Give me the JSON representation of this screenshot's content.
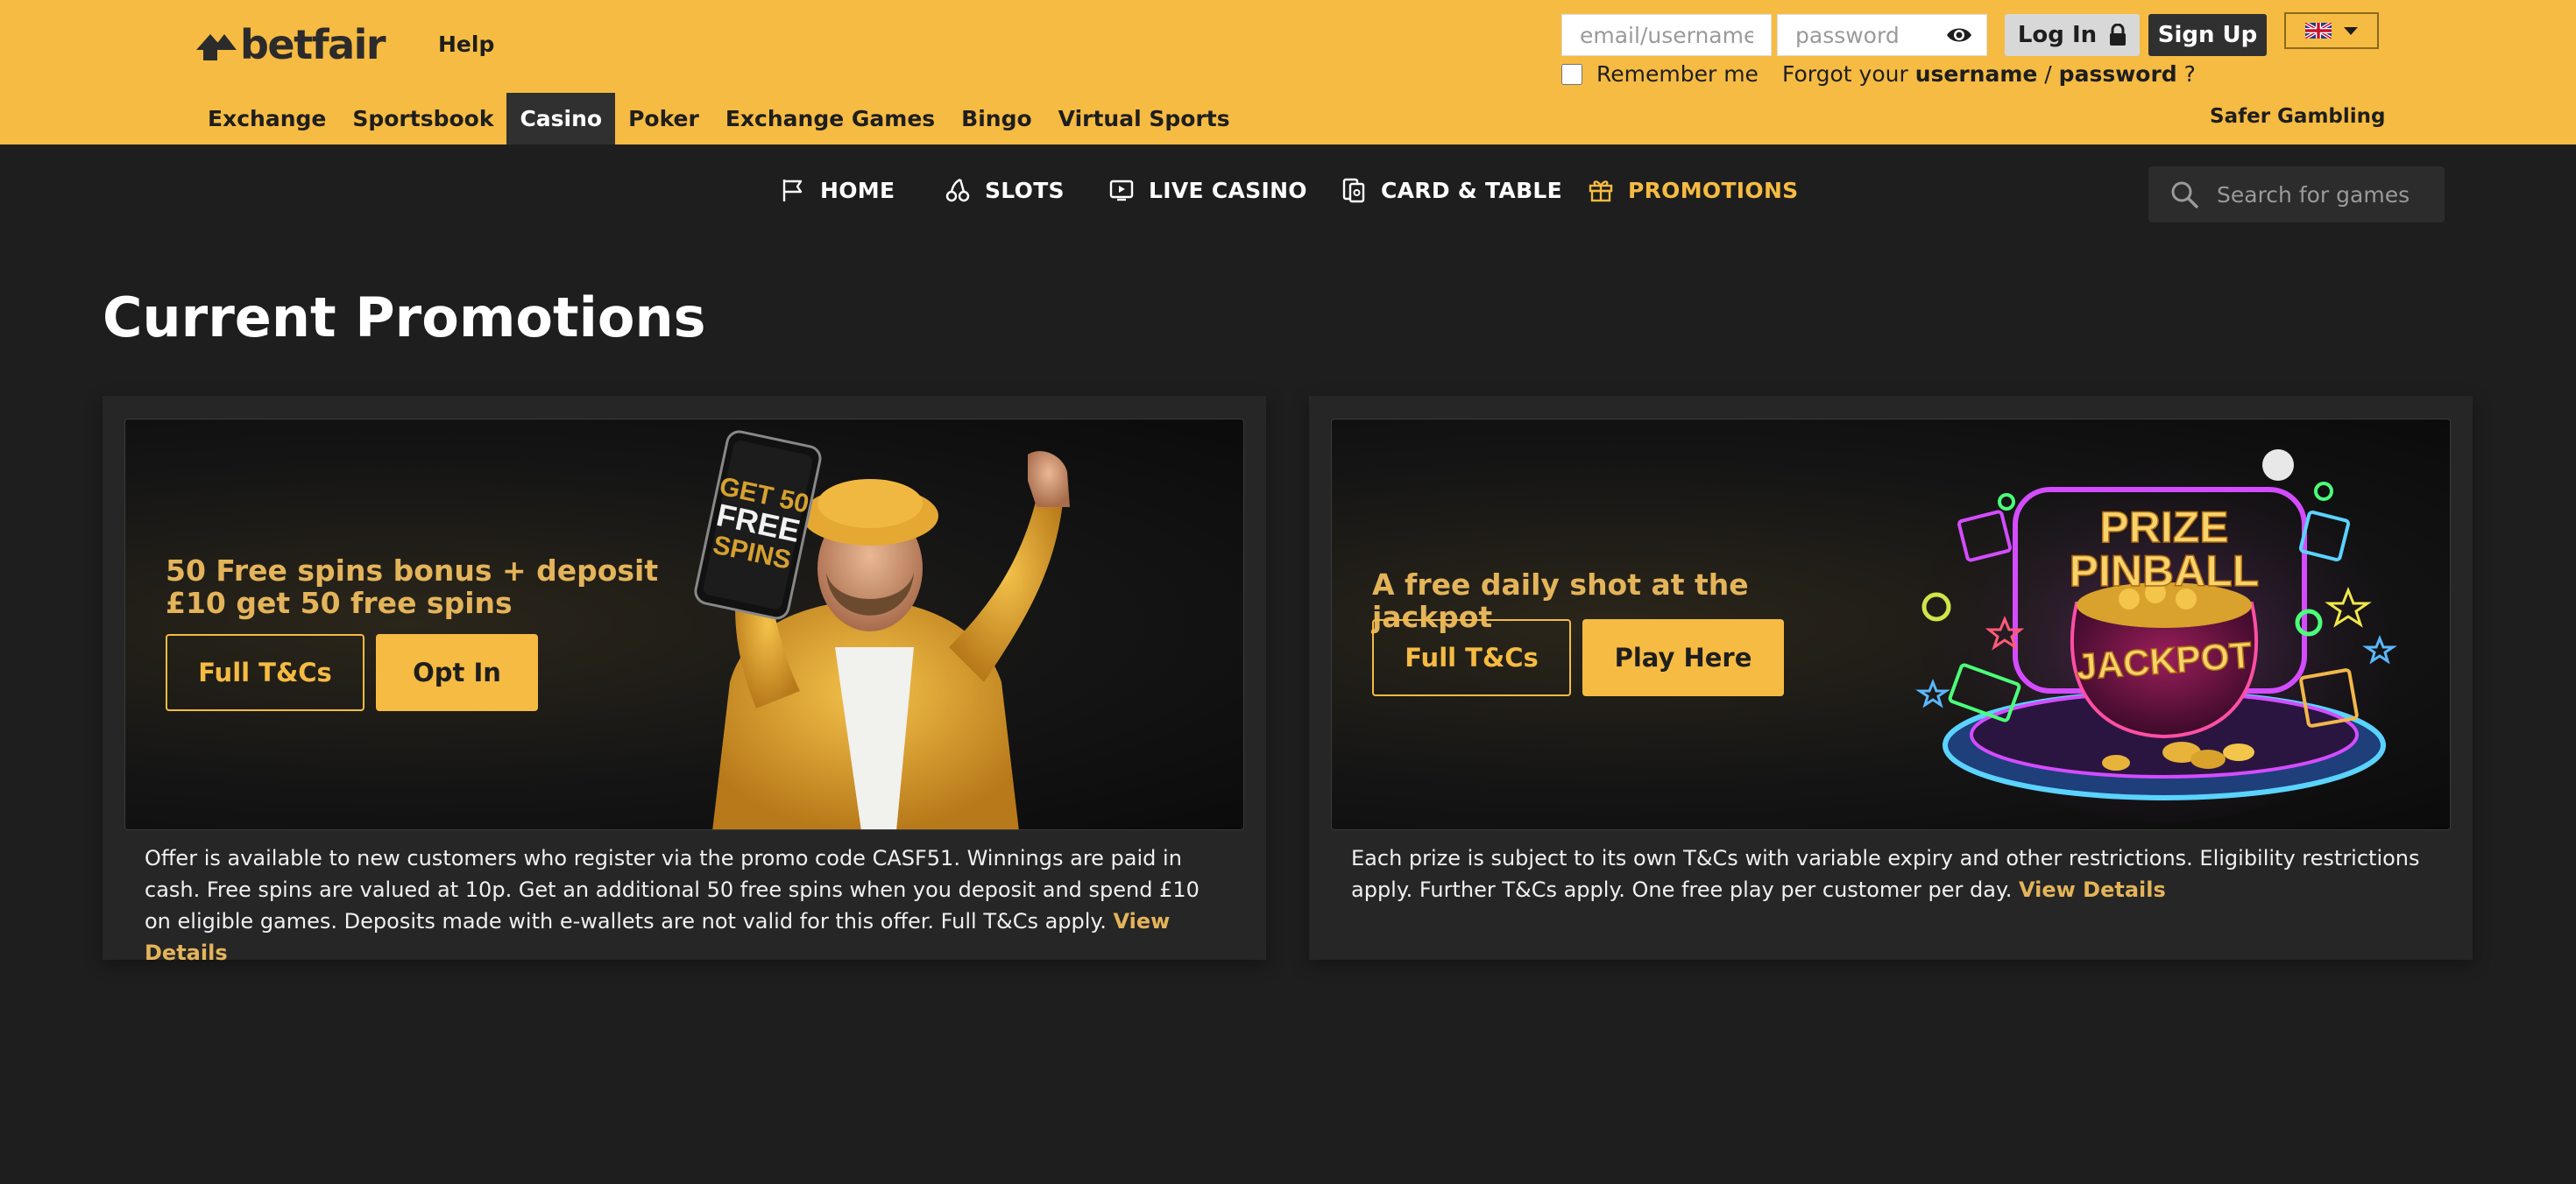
{
  "header": {
    "logo_text": "betfair",
    "help_label": "Help",
    "email_placeholder": "email/username",
    "password_placeholder": "password",
    "login_label": "Log In",
    "signup_label": "Sign Up",
    "remember_label": "Remember me",
    "forgot_prefix": "Forgot your ",
    "forgot_username": "username",
    "forgot_sep": " / ",
    "forgot_password": "password",
    "forgot_suffix": " ?",
    "safer_gambling": "Safer Gambling",
    "brand_color": "#f6bb42",
    "product_nav": [
      {
        "label": "Exchange",
        "active": false
      },
      {
        "label": "Sportsbook",
        "active": false
      },
      {
        "label": "Casino",
        "active": true
      },
      {
        "label": "Poker",
        "active": false
      },
      {
        "label": "Exchange Games",
        "active": false
      },
      {
        "label": "Bingo",
        "active": false
      },
      {
        "label": "Virtual Sports",
        "active": false
      }
    ]
  },
  "casino_nav": {
    "items": [
      {
        "label": "HOME",
        "icon": "flag-icon",
        "active": false
      },
      {
        "label": "SLOTS",
        "icon": "cherries-icon",
        "active": false
      },
      {
        "label": "LIVE CASINO",
        "icon": "live-play-icon",
        "active": false
      },
      {
        "label": "CARD & TABLE",
        "icon": "cards-icon",
        "active": false
      },
      {
        "label": "PROMOTIONS",
        "icon": "gift-icon",
        "active": true
      }
    ],
    "search_placeholder": "Search for games"
  },
  "main": {
    "title": "Current Promotions",
    "promos": [
      {
        "title": "50 Free spins bonus + deposit £10 get 50 free spins",
        "image_text": [
          "GET 50",
          "FREE",
          "SPINS"
        ],
        "secondary_label": "Full T&Cs",
        "primary_label": "Opt In",
        "description": "Offer is available to new customers who register via the promo code CASF51. Winnings are paid in cash. Free spins are valued at 10p. Get an additional 50 free spins when you deposit and spend £10 on eligible games. Deposits made with e-wallets are not valid for this offer. Full T&Cs apply.",
        "details_label": "View Details"
      },
      {
        "title": "A free daily shot at the jackpot",
        "image_text": [
          "PRIZE",
          "PINBALL",
          "JACKPOT"
        ],
        "secondary_label": "Full T&Cs",
        "primary_label": "Play Here",
        "description": "Each prize is subject to its own T&Cs with variable expiry and other restrictions. Eligibility restrictions apply. Further T&Cs apply. One free play per customer per day.",
        "details_label": "View Details"
      }
    ]
  }
}
